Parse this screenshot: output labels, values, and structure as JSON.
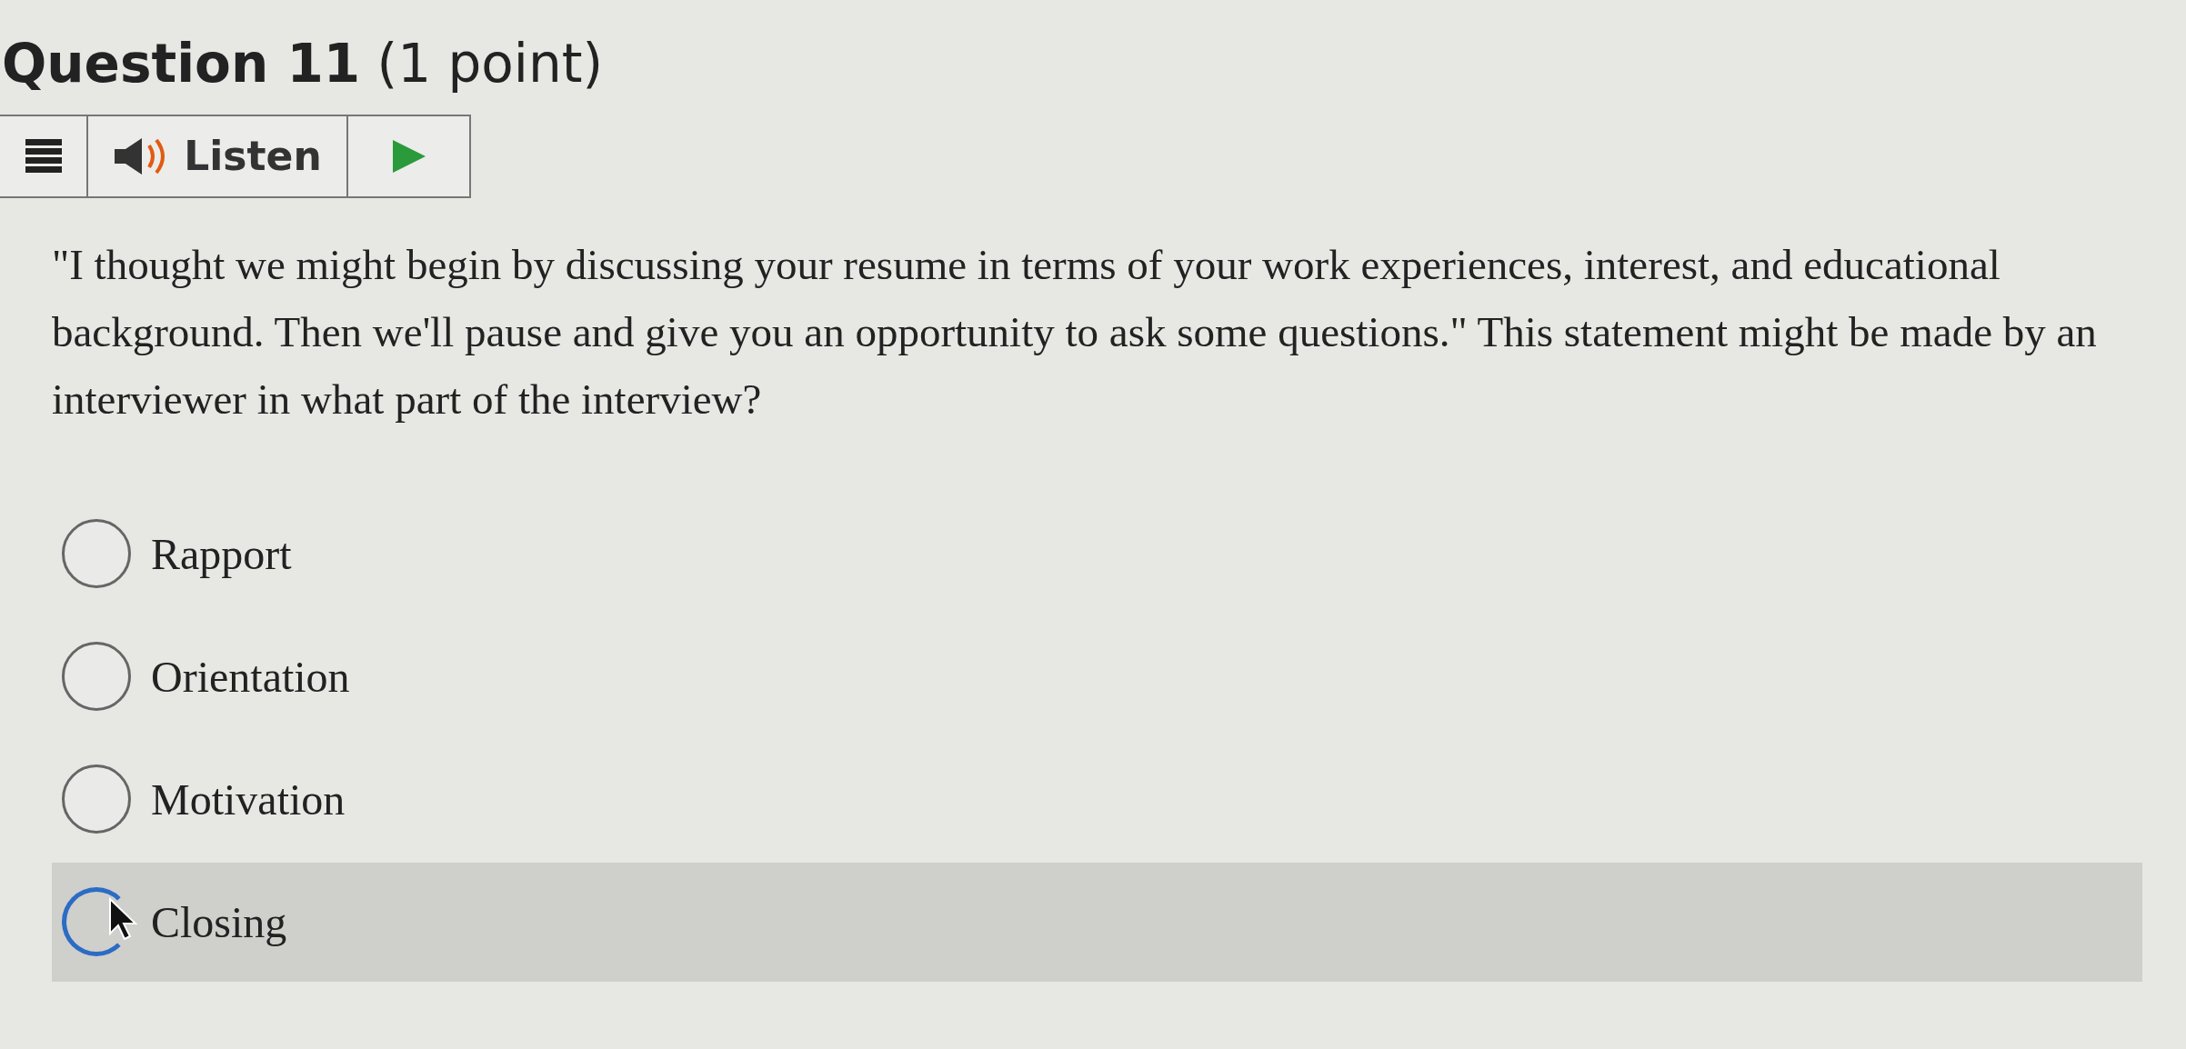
{
  "question": {
    "title": "Question 11",
    "points": "(1 point)"
  },
  "listen_bar": {
    "label": "Listen"
  },
  "prompt": "\"I thought we might begin by discussing your resume in terms of your work experiences, interest, and educational background. Then we'll pause and give you an opportunity to ask some questions.\" This statement might be made by an interviewer in what part of the interview?",
  "options": [
    {
      "label": "Rapport",
      "selected": false,
      "hovered": false
    },
    {
      "label": "Orientation",
      "selected": false,
      "hovered": false
    },
    {
      "label": "Motivation",
      "selected": false,
      "hovered": false
    },
    {
      "label": "Closing",
      "selected": false,
      "hovered": true
    }
  ]
}
